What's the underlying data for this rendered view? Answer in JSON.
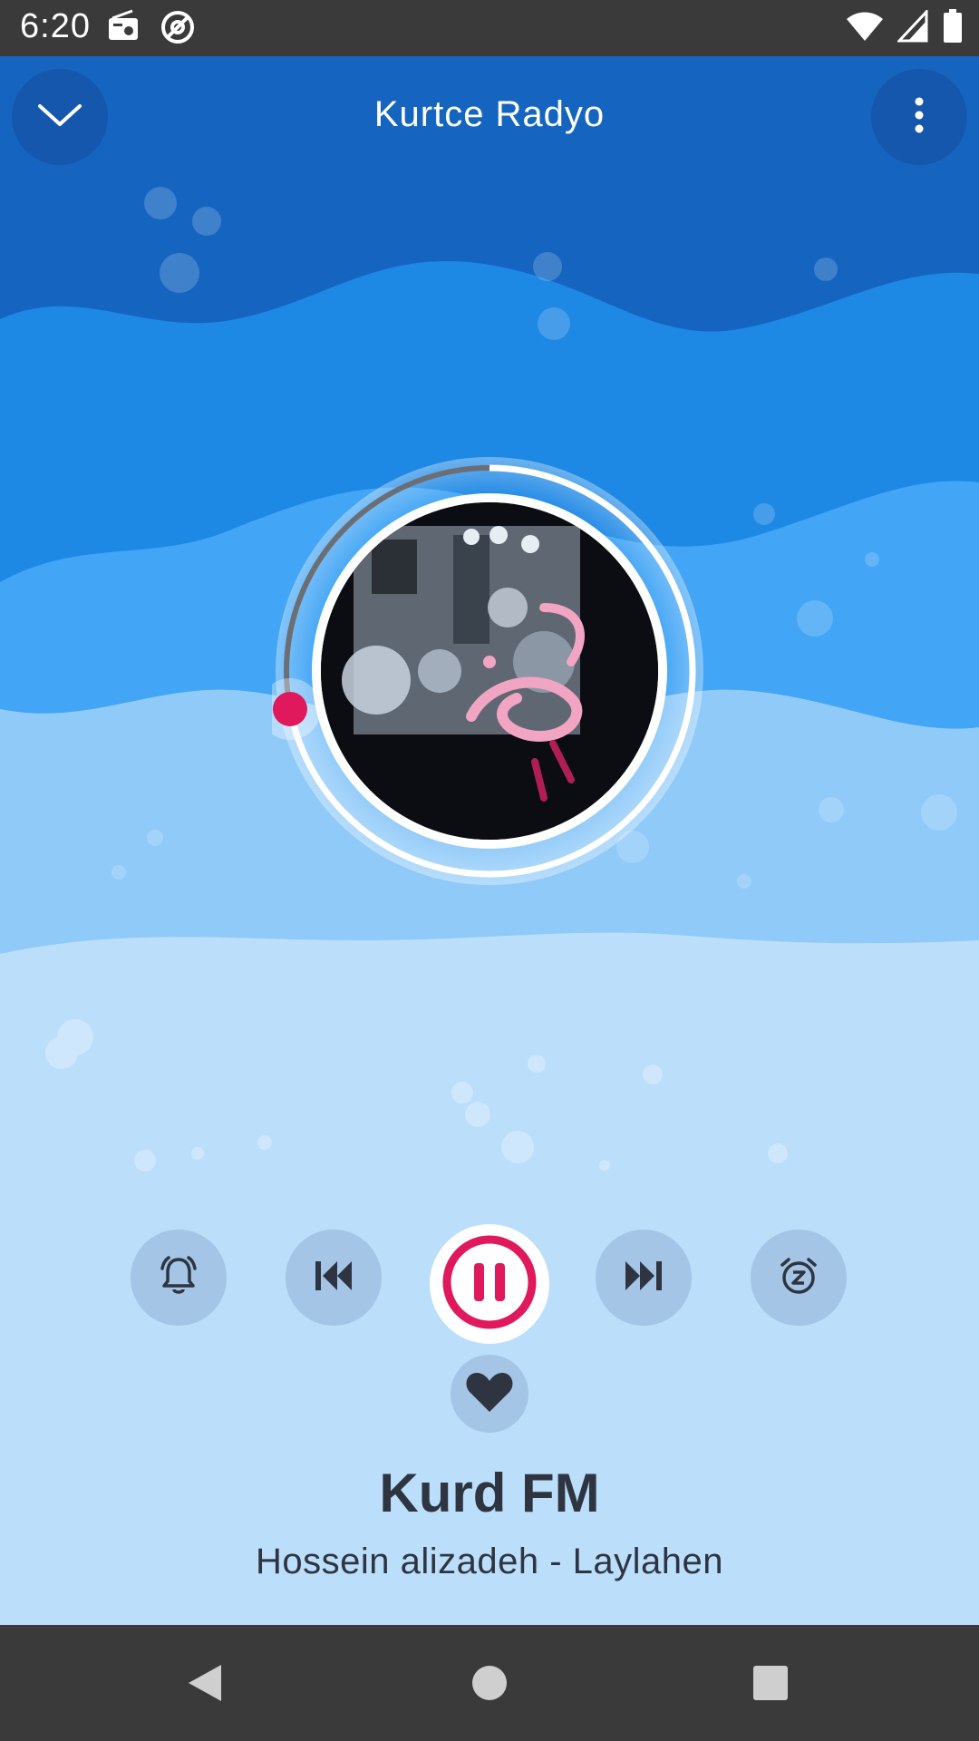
{
  "status_bar": {
    "time": "6:20",
    "icons_left": [
      "radio-icon",
      "at-icon"
    ],
    "icons_right": [
      "wifi-icon",
      "cell-signal-icon",
      "battery-icon"
    ]
  },
  "app_bar": {
    "title": "Kurtce Radyo",
    "collapse_icon": "chevron-down-icon",
    "more_icon": "more-vert-icon"
  },
  "player": {
    "station_name": "Kurd FM",
    "track_title": "Hossein alizadeh - Laylahen",
    "progress": 0.72,
    "state": "playing"
  },
  "controls": {
    "alarm_icon": "alarm-bell-icon",
    "previous_icon": "skip-previous-icon",
    "play_pause_icon": "pause-icon",
    "next_icon": "skip-next-icon",
    "sleep_timer_icon": "sleep-timer-icon",
    "favorite_icon": "heart-icon"
  },
  "colors": {
    "accent": "#e0185c",
    "wave_dark": "#1565c0",
    "wave_mid": "#1e88e5",
    "wave_light": "#42a5f5",
    "wave_lighter": "#90caf9",
    "wave_lightest": "#bbdefb",
    "system_bar": "#3a3a3a"
  },
  "nav_bar": {
    "back_icon": "back-triangle-icon",
    "home_icon": "home-circle-icon",
    "recents_icon": "recents-square-icon"
  }
}
